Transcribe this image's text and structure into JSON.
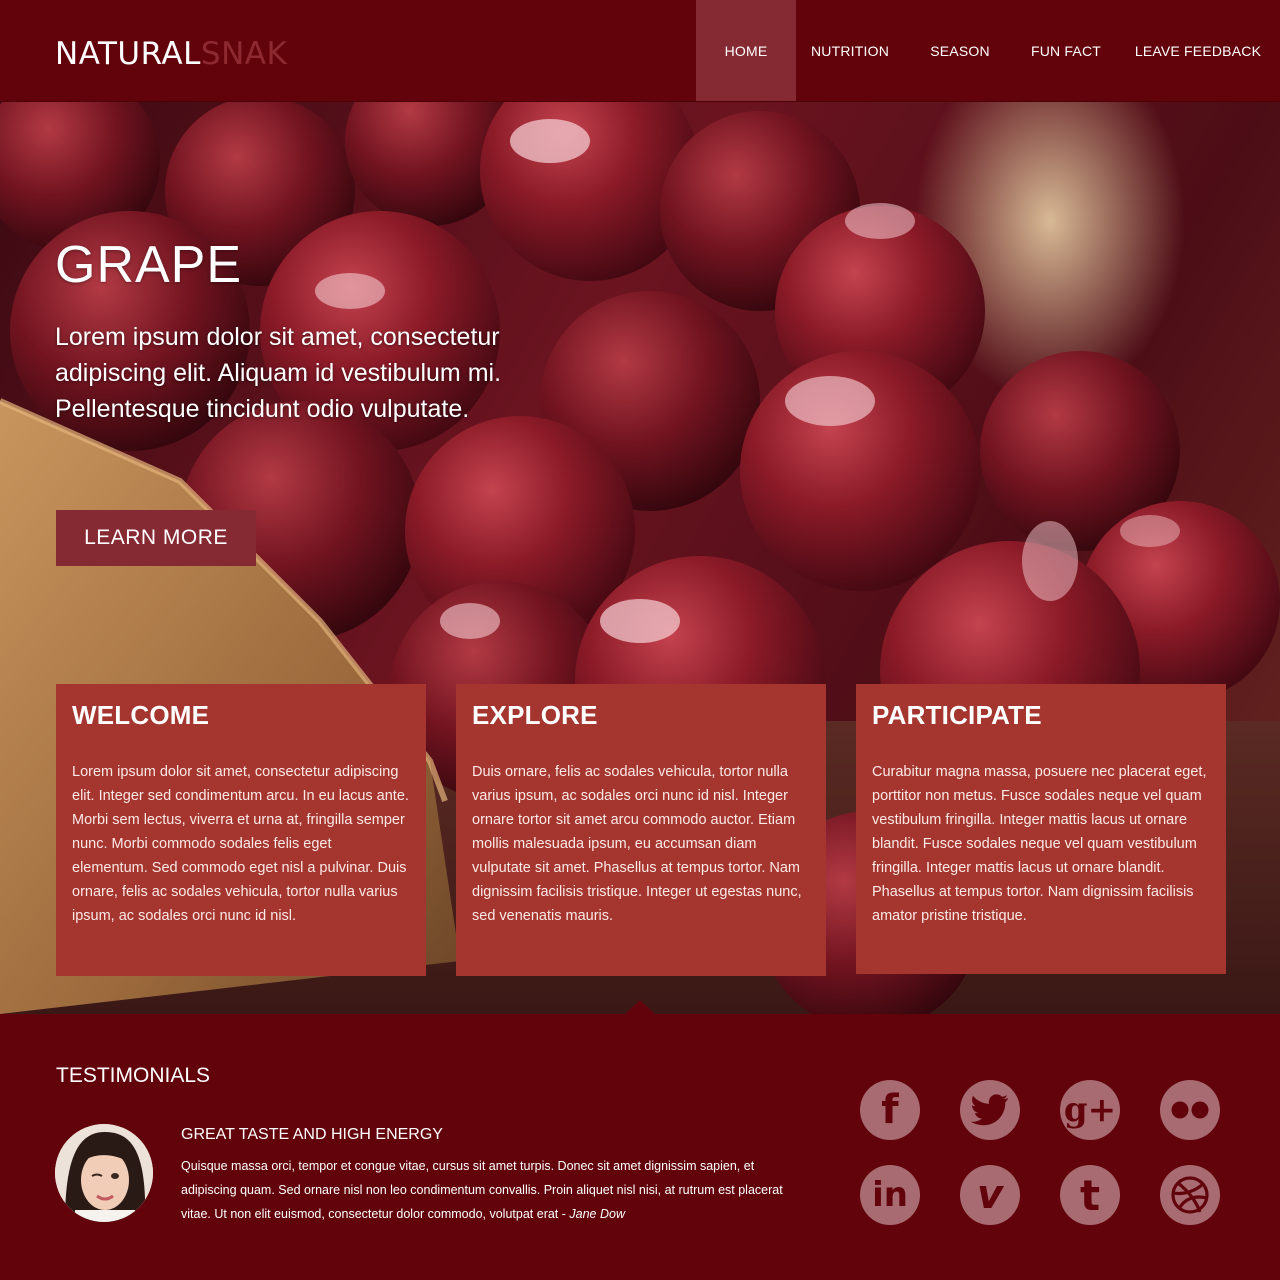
{
  "brand": {
    "part1": "NATURAL",
    "part2": "SNAK"
  },
  "nav": [
    {
      "label": "HOME",
      "active": true
    },
    {
      "label": "NUTRITION"
    },
    {
      "label": "SEASON"
    },
    {
      "label": "FUN FACT"
    },
    {
      "label": "LEAVE FEEDBACK"
    }
  ],
  "hero": {
    "title": "GRAPE",
    "text": "Lorem ipsum dolor sit amet, consectetur adipiscing elit. Aliquam id vestibulum mi. Pellentesque tincidunt odio vulputate.",
    "button": "LEARN MORE"
  },
  "cards": [
    {
      "title": "WELCOME",
      "text": "Lorem ipsum dolor sit amet, consectetur adipiscing elit. Integer sed condimentum arcu. In eu lacus ante. Morbi sem lectus, viverra et urna at, fringilla semper nunc. Morbi commodo sodales felis eget elementum. Sed commodo eget nisl a pulvinar. Duis ornare, felis ac sodales vehicula, tortor nulla varius ipsum, ac sodales orci nunc id nisl."
    },
    {
      "title": "EXPLORE",
      "text": "Duis ornare, felis ac sodales vehicula, tortor nulla varius ipsum, ac sodales orci nunc id nisl. Integer ornare tortor sit amet arcu commodo auctor. Etiam mollis malesuada ipsum, eu accumsan diam vulputate sit amet. Phasellus at tempus tortor. Nam dignissim facilisis tristique. Integer ut egestas nunc, sed venenatis mauris."
    },
    {
      "title": "PARTICIPATE",
      "text": "Curabitur magna massa, posuere nec placerat eget, porttitor non metus. Fusce sodales neque vel quam vestibulum fringilla. Integer mattis lacus ut ornare blandit. Fusce sodales neque vel quam vestibulum fringilla. Integer mattis lacus ut ornare blandit. Phasellus at tempus tortor. Nam dignissim facilisis amator pristine tristique."
    }
  ],
  "testimonials": {
    "title": "TESTIMONIALS",
    "quote_title": "GREAT TASTE AND HIGH ENERGY",
    "quote": "Quisque massa orci, tempor et congue vitae, cursus sit amet turpis. Donec sit amet dignissim sapien, et adipiscing quam. Sed ornare nisl non leo condimentum convallis. Proin aliquet nisl nisi, at rutrum est placerat vitae. Ut non elit euismod, consectetur dolor commodo, volutpat erat - ",
    "author": "Jane Dow"
  },
  "social": [
    {
      "icon": "facebook-icon",
      "glyph": "f"
    },
    {
      "icon": "twitter-icon",
      "glyph": ""
    },
    {
      "icon": "google-plus-icon",
      "glyph": "g+"
    },
    {
      "icon": "flickr-icon",
      "glyph": ""
    },
    {
      "icon": "linkedin-icon",
      "glyph": "in"
    },
    {
      "icon": "vimeo-icon",
      "glyph": "v"
    },
    {
      "icon": "tumblr-icon",
      "glyph": "t"
    },
    {
      "icon": "dribbble-icon",
      "glyph": ""
    }
  ],
  "colors": {
    "primary": "#62030b",
    "accent": "#852a33",
    "card": "#a5352f",
    "brand_secondary": "#8d2a31",
    "social_icon": "#a86b72"
  }
}
